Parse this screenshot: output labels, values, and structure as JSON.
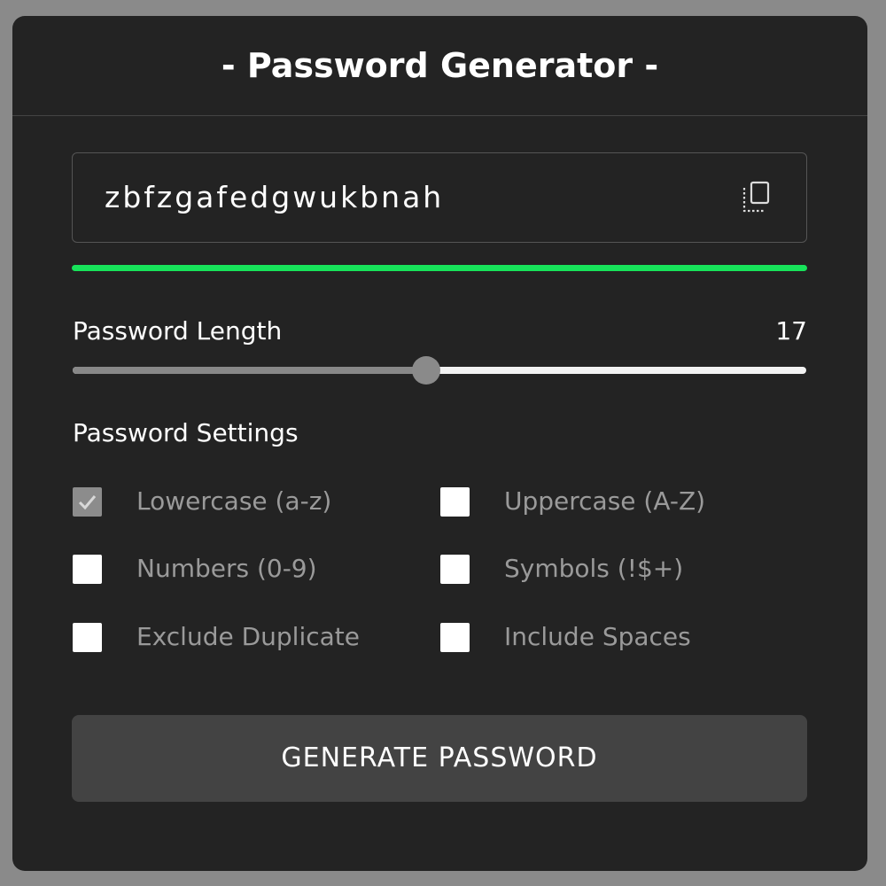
{
  "app": {
    "title": "- Password Generator -"
  },
  "password": {
    "value": "zbfzgafedgwukbnah",
    "copy_icon": "copy-icon",
    "strength_color": "#17e35a"
  },
  "length": {
    "label": "Password Length",
    "value": "17",
    "slider_fraction": 0.482
  },
  "settings": {
    "label": "Password Settings",
    "options": [
      {
        "label": "Lowercase (a-z)",
        "checked": true
      },
      {
        "label": "Uppercase (A-Z)",
        "checked": false
      },
      {
        "label": "Numbers (0-9)",
        "checked": false
      },
      {
        "label": "Symbols (!$+)",
        "checked": false
      },
      {
        "label": "Exclude Duplicate",
        "checked": false
      },
      {
        "label": "Include Spaces",
        "checked": false
      }
    ]
  },
  "generate": {
    "label": "GENERATE PASSWORD"
  },
  "colors": {
    "card_background": "#232323",
    "page_background": "#8a8a8a",
    "button_background": "#434343"
  }
}
